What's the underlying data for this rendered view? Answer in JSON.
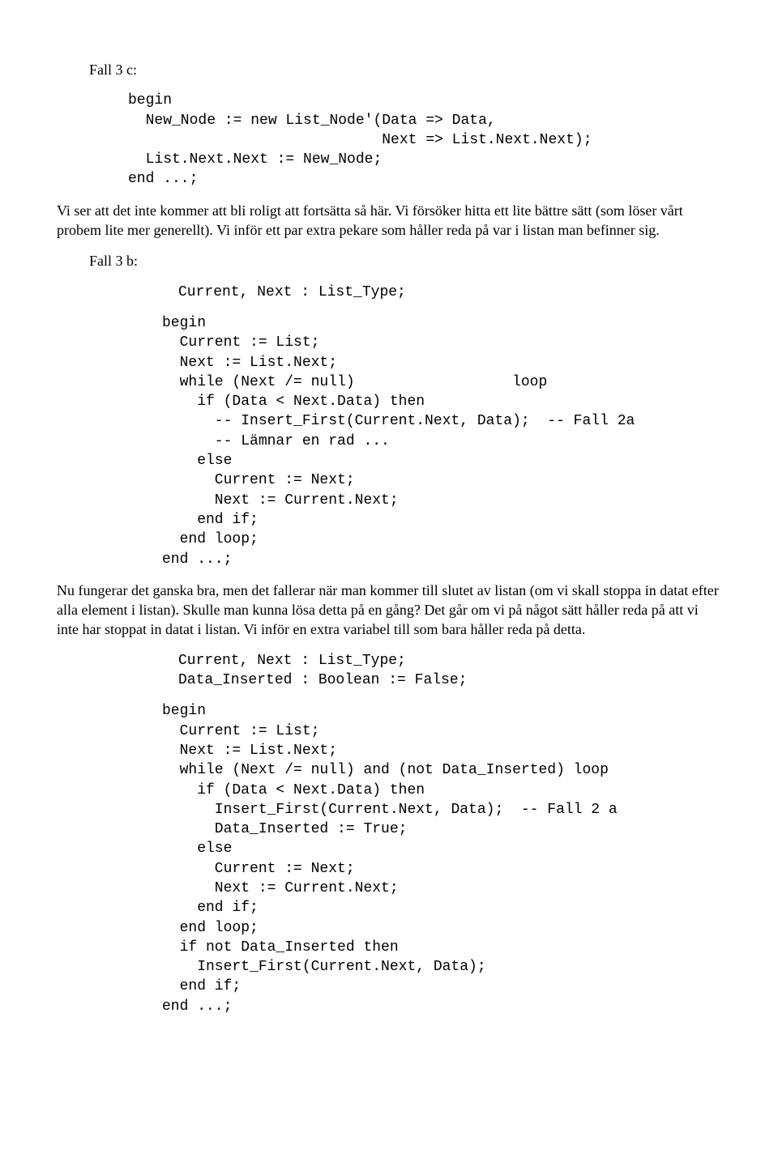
{
  "label1": "Fall 3 c:",
  "code1": "begin\n  New_Node := new List_Node'(Data => Data,\n                             Next => List.Next.Next);\n  List.Next.Next := New_Node;\nend ...;",
  "para1": "Vi ser att det inte kommer att bli roligt att fortsätta så här. Vi försöker hitta ett lite bättre sätt (som löser vårt probem lite mer generellt). Vi inför ett par extra pekare som håller reda på var i listan man befinner sig.",
  "label2": "Fall 3 b:",
  "code2a": "Current, Next : List_Type;",
  "code2b": "begin\n  Current := List;\n  Next := List.Next;\n  while (Next /= null)                  loop\n    if (Data < Next.Data) then\n      -- Insert_First(Current.Next, Data);  -- Fall 2a\n      -- Lämnar en rad ...\n    else\n      Current := Next;\n      Next := Current.Next;\n    end if;\n  end loop;\nend ...;",
  "para2": "Nu fungerar det ganska bra, men det fallerar när man kommer till slutet av listan (om vi skall stoppa in datat efter alla element i listan). Skulle man kunna lösa detta på en gång? Det går om vi på något sätt håller reda på att vi inte har stoppat in datat i listan. Vi inför en extra variabel till som bara håller reda på detta.",
  "code3a": "Current, Next : List_Type;\nData_Inserted : Boolean := False;",
  "code3b": "begin\n  Current := List;\n  Next := List.Next;\n  while (Next /= null) and (not Data_Inserted) loop\n    if (Data < Next.Data) then\n      Insert_First(Current.Next, Data);  -- Fall 2 a\n      Data_Inserted := True;\n    else\n      Current := Next;\n      Next := Current.Next;\n    end if;\n  end loop;\n  if not Data_Inserted then\n    Insert_First(Current.Next, Data);\n  end if;\nend ...;"
}
